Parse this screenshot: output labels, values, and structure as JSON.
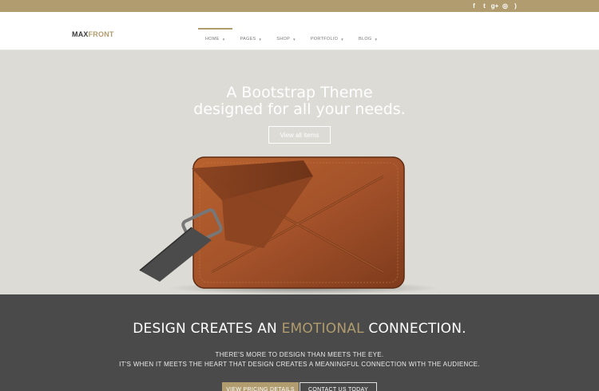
{
  "social": {
    "icons": [
      "facebook-icon",
      "twitter-icon",
      "google-plus-icon",
      "dribbble-icon",
      "rss-icon"
    ],
    "glyphs": [
      "f",
      "t",
      "g+",
      "◎",
      ")"
    ]
  },
  "header": {
    "logo_part1": "MAX",
    "logo_part2": "FRONT"
  },
  "nav": {
    "items": [
      {
        "label": "HOME"
      },
      {
        "label": "PAGES"
      },
      {
        "label": "SHOP"
      },
      {
        "label": "PORTFOLIO"
      },
      {
        "label": "BLOG"
      }
    ],
    "caret": "▼"
  },
  "hero": {
    "title_line1": "A Bootstrap Theme",
    "title_line2": "designed for all your needs.",
    "button_label": "View all items"
  },
  "band": {
    "title_before": "DESIGN CREATES AN ",
    "title_accent": "EMOTIONAL",
    "title_after": " CONNECTION.",
    "text_line1": "THERE'S MORE TO DESIGN THAN MEETS THE EYE.",
    "text_line2": "IT'S WHEN IT MEETS THE HEART THAT DESIGN CREATES A MEANINGFUL CONNECTION WITH THE AUDIENCE.",
    "pricing_label": "VIEW PRICING DETAILS",
    "contact_label": "CONTACT US TODAY"
  },
  "colors": {
    "accent": "#b09c6e",
    "hero_bg": "#dcdbd5",
    "band_bg": "#4a4a4a",
    "bag_leather": "#a4522a"
  }
}
